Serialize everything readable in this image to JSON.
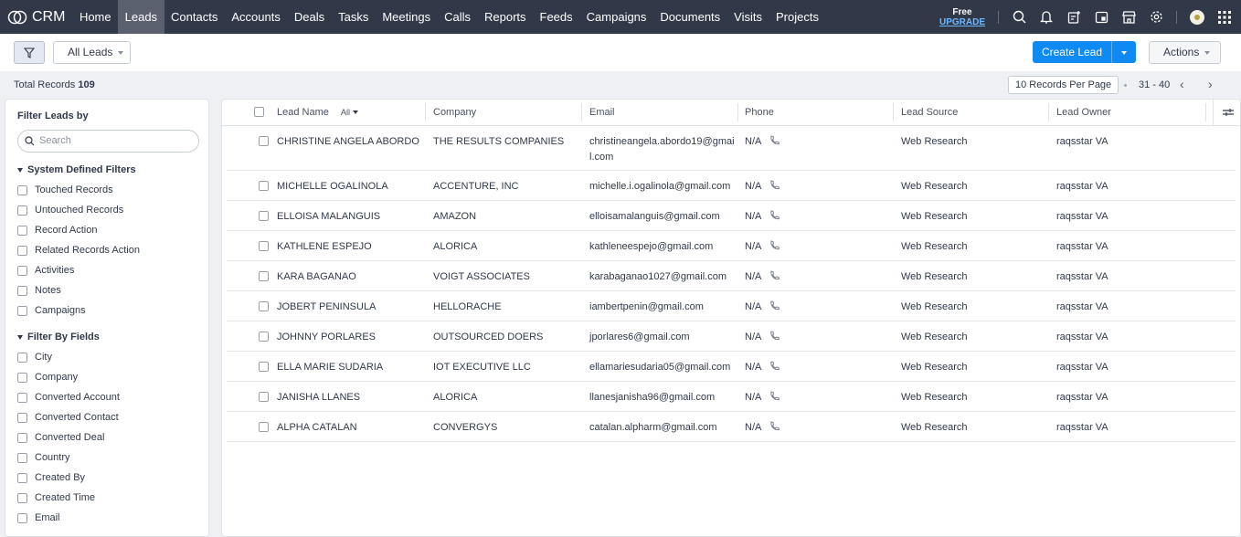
{
  "nav": {
    "brand": "CRM",
    "tabs": [
      "Home",
      "Leads",
      "Contacts",
      "Accounts",
      "Deals",
      "Tasks",
      "Meetings",
      "Calls",
      "Reports",
      "Feeds",
      "Campaigns",
      "Documents",
      "Visits",
      "Projects"
    ],
    "active": "Leads",
    "plan": "Free",
    "upgrade": "UPGRADE"
  },
  "toolbar": {
    "view": "All Leads",
    "create": "Create Lead",
    "actions": "Actions"
  },
  "summary": {
    "label": "Total Records",
    "count": "109",
    "per_page": "10 Records Per Page",
    "range": "31 - 40"
  },
  "sidebar": {
    "title": "Filter Leads by",
    "search_placeholder": "Search",
    "system_title": "System Defined Filters",
    "system": [
      "Touched Records",
      "Untouched Records",
      "Record Action",
      "Related Records Action",
      "Activities",
      "Notes",
      "Campaigns"
    ],
    "fields_title": "Filter By Fields",
    "fields": [
      "City",
      "Company",
      "Converted Account",
      "Converted Contact",
      "Converted Deal",
      "Country",
      "Created By",
      "Created Time",
      "Email"
    ]
  },
  "table": {
    "headers": {
      "name": "Lead Name",
      "all": "All",
      "company": "Company",
      "email": "Email",
      "phone": "Phone",
      "source": "Lead Source",
      "owner": "Lead Owner"
    },
    "rows": [
      {
        "name": "CHRISTINE ANGELA ABORDO",
        "company": "THE RESULTS COMPANIES",
        "email": "christineangela.abordo19@gmail.com",
        "phone": "N/A",
        "source": "Web Research",
        "owner": "raqsstar VA"
      },
      {
        "name": "MICHELLE OGALINOLA",
        "company": "ACCENTURE, INC",
        "email": "michelle.i.ogalinola@gmail.com",
        "phone": "N/A",
        "source": "Web Research",
        "owner": "raqsstar VA"
      },
      {
        "name": "ELLOISA MALANGUIS",
        "company": "AMAZON",
        "email": "elloisamalanguis@gmail.com",
        "phone": "N/A",
        "source": "Web Research",
        "owner": "raqsstar VA"
      },
      {
        "name": "KATHLENE ESPEJO",
        "company": "ALORICA",
        "email": "kathleneespejo@gmail.com",
        "phone": "N/A",
        "source": "Web Research",
        "owner": "raqsstar VA"
      },
      {
        "name": "KARA BAGANAO",
        "company": "VOIGT ASSOCIATES",
        "email": "karabaganao1027@gmail.com",
        "phone": "N/A",
        "source": "Web Research",
        "owner": "raqsstar VA"
      },
      {
        "name": "JOBERT PENINSULA",
        "company": "HELLORACHE",
        "email": "iambertpenin@gmail.com",
        "phone": "N/A",
        "source": "Web Research",
        "owner": "raqsstar VA"
      },
      {
        "name": "JOHNNY PORLARES",
        "company": "OUTSOURCED DOERS",
        "email": "jporlares6@gmail.com",
        "phone": "N/A",
        "source": "Web Research",
        "owner": "raqsstar VA"
      },
      {
        "name": "ELLA MARIE SUDARIA",
        "company": "IOT EXECUTIVE LLC",
        "email": "ellamariesudaria05@gmail.com",
        "phone": "N/A",
        "source": "Web Research",
        "owner": "raqsstar VA"
      },
      {
        "name": "JANISHA LLANES",
        "company": "ALORICA",
        "email": "llanesjanisha96@gmail.com",
        "phone": "N/A",
        "source": "Web Research",
        "owner": "raqsstar VA"
      },
      {
        "name": "ALPHA CATALAN",
        "company": "CONVERGYS",
        "email": "catalan.alpharm@gmail.com",
        "phone": "N/A",
        "source": "Web Research",
        "owner": "raqsstar VA"
      }
    ]
  }
}
